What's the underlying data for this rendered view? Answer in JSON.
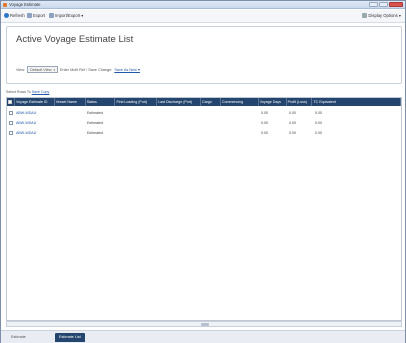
{
  "window": {
    "title": "Voyage Estimate"
  },
  "toolbar": {
    "refresh_label": "Refresh",
    "export_label": "Export",
    "import_export_label": "Import/Export ▾",
    "display_options_label": "Display Options ▾"
  },
  "header": {
    "title": "Active Voyage Estimate List",
    "view_label": "View:",
    "view_value": "Default View",
    "filter_text": "Enter Multi Ref / Save Change:",
    "filter_link": "Save As New ▾"
  },
  "select_row": {
    "label": "Select Rows To",
    "link": "Save Copy"
  },
  "table": {
    "columns": [
      "Voyage Estimate ID",
      "Vessel Name",
      "Status",
      "First Loading (Port)",
      "Last Discharge (Port)",
      "Cargo",
      "Commencing",
      "Voyage Days",
      "Profit (Loss)",
      "TC Equivalent"
    ],
    "rows": [
      {
        "id": "ABW-WDAU",
        "vessel": "",
        "status": "Estimated",
        "first_port": "",
        "last_port": "",
        "cargo": "",
        "commencing": "",
        "days": "0.00",
        "profit": "0.00",
        "tce": "0.00"
      },
      {
        "id": "ABW-WDAU",
        "vessel": "",
        "status": "Estimated",
        "first_port": "",
        "last_port": "",
        "cargo": "",
        "commencing": "",
        "days": "0.00",
        "profit": "0.00",
        "tce": "0.00"
      },
      {
        "id": "ABW-WDAU",
        "vessel": "",
        "status": "Estimated",
        "first_port": "",
        "last_port": "",
        "cargo": "",
        "commencing": "",
        "days": "0.00",
        "profit": "0.00",
        "tce": "0.00"
      }
    ]
  },
  "tabs": [
    {
      "label": "Estimate",
      "active": false
    },
    {
      "label": "Estimate List",
      "active": true
    }
  ]
}
